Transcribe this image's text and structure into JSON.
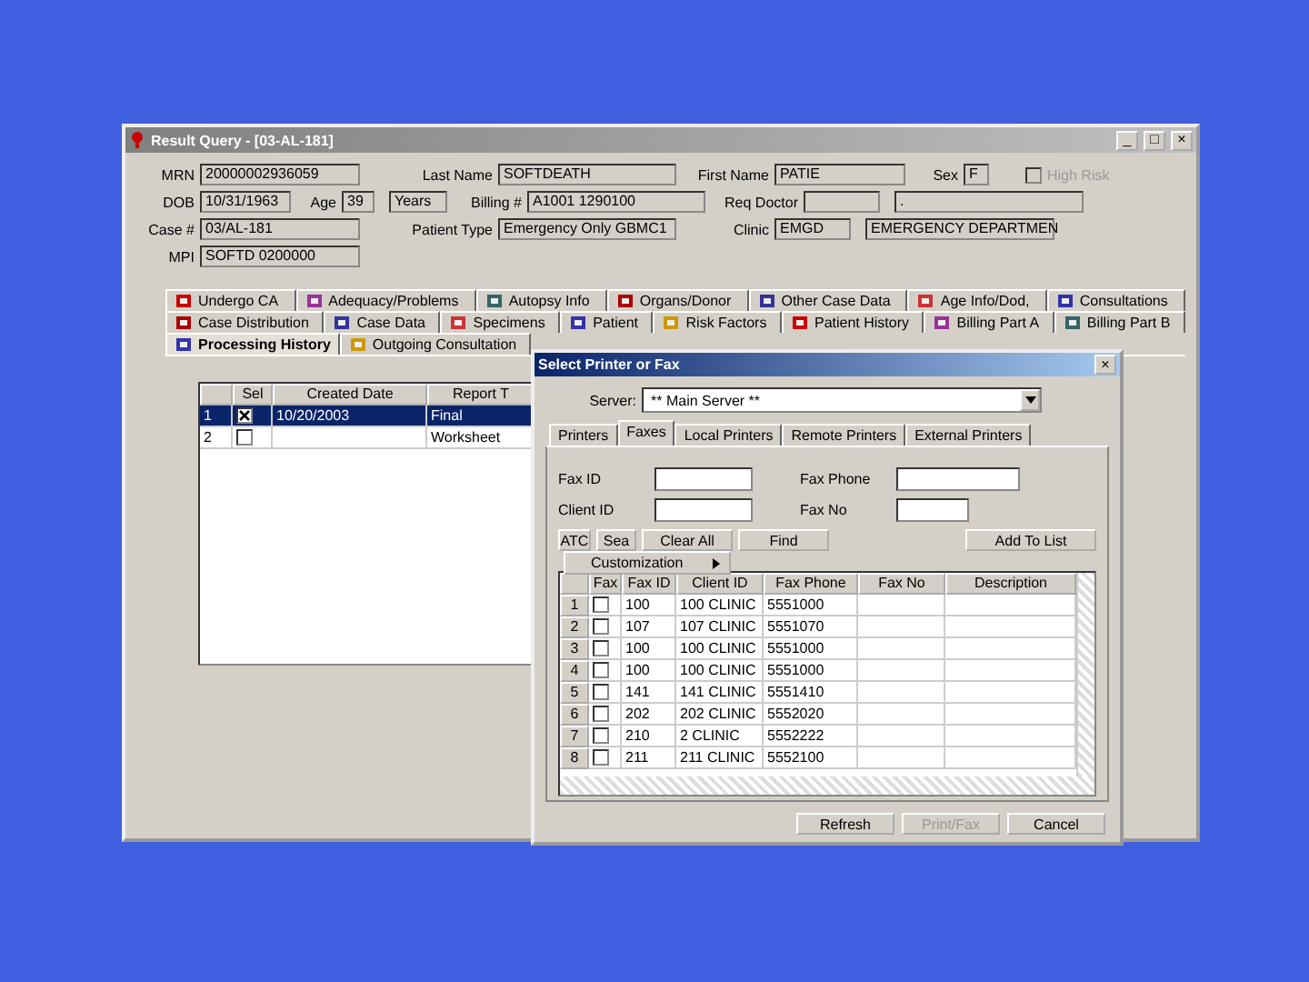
{
  "window": {
    "title": "Result Query - [03-AL-181]",
    "controls": [
      "_",
      "□",
      "×"
    ]
  },
  "header": {
    "fields": [
      {
        "label": "MRN",
        "value": "20000002936059"
      },
      {
        "label": "Last Name",
        "value": "SOFTDEATH"
      },
      {
        "label": "First Name",
        "value": "PATIE"
      },
      {
        "label": "Sex",
        "value": "F",
        "kind": "combo"
      },
      {
        "label": "High Risk",
        "kind": "check",
        "checked": false,
        "disabled": true
      },
      {
        "label": "DOB",
        "value": "10/31/1963"
      },
      {
        "label": "Age",
        "value": "39"
      },
      {
        "value": "Years"
      },
      {
        "label": "Billing #",
        "value": "A1001 1290100"
      },
      {
        "label": "Req Doctor"
      },
      {
        "value": "."
      },
      {
        "label": "Case #",
        "value": "03/AL-181"
      },
      {
        "label": "Patient Type",
        "value": "Emergency Only GBMC1"
      },
      {
        "label": "Clinic",
        "value": "EMGD"
      },
      {
        "value": "EMERGENCY DEPARTMEN"
      },
      {
        "label": "MPI",
        "value": "SOFTD 0200000"
      }
    ]
  },
  "tab_rows": [
    [
      {
        "label": "Undergo CA",
        "selected": false
      },
      {
        "label": "Adequacy/Problems",
        "selected": false
      },
      {
        "label": "Autopsy Info",
        "selected": false
      },
      {
        "label": "Organs/Donor",
        "selected": false
      },
      {
        "label": "Other Case Data",
        "selected": false
      },
      {
        "label": "Age Info/Dod,",
        "selected": false
      },
      {
        "label": "Consultations",
        "selected": false
      }
    ],
    [
      {
        "label": "Case Distribution",
        "selected": false
      },
      {
        "label": "Case Data",
        "selected": false
      },
      {
        "label": "Specimens",
        "selected": false
      },
      {
        "label": "Patient",
        "selected": false
      },
      {
        "label": "Risk Factors",
        "selected": false
      },
      {
        "label": "Patient History",
        "selected": false
      },
      {
        "label": "Billing Part A",
        "selected": false
      },
      {
        "label": "Billing Part B",
        "selected": false
      }
    ],
    [
      {
        "label": "Processing History",
        "selected": true
      },
      {
        "label": "Outgoing Consultation",
        "selected": false
      }
    ]
  ],
  "reports": {
    "columns": [
      "Sel",
      "Created Date",
      "Report T"
    ],
    "rows": [
      {
        "num": "1",
        "checked": true,
        "date": "10/20/2003",
        "type": "Final",
        "selected": true
      },
      {
        "num": "2",
        "checked": false,
        "type": "Worksheet",
        "selected": false
      }
    ]
  },
  "dialog": {
    "title": "Select Printer or Fax",
    "close": "×",
    "server_label": "Server:",
    "server": "** Main Server **",
    "tabs": [
      {
        "label": "Printers",
        "selected": false
      },
      {
        "label": "Faxes",
        "selected": true
      },
      {
        "label": "Local Printers",
        "selected": false
      },
      {
        "label": "Remote Printers",
        "selected": false
      },
      {
        "label": "External Printers",
        "selected": false
      }
    ],
    "fields": [
      {
        "label": "Fax ID"
      },
      {
        "label": "Fax Phone"
      },
      {
        "label": "Client ID"
      },
      {
        "label": "Fax No"
      }
    ],
    "buttons": [
      "ATC",
      "Sea",
      "Clear All",
      "Find",
      "Add To List"
    ],
    "menu": {
      "label": "Customization"
    },
    "columns": [
      "Fax",
      "Fax ID",
      "Client ID",
      "Fax Phone",
      "Fax No",
      "Description"
    ],
    "rows": [
      {
        "num": "1",
        "checked": false,
        "id": "100",
        "client": "100 CLINIC",
        "phone": "5551000"
      },
      {
        "num": "2",
        "checked": false,
        "id": "107",
        "client": "107 CLINIC",
        "phone": "5551070"
      },
      {
        "num": "3",
        "checked": false,
        "id": "100",
        "client": "100 CLINIC",
        "phone": "5551000"
      },
      {
        "num": "4",
        "checked": false,
        "id": "100",
        "client": "100 CLINIC",
        "phone": "5551000"
      },
      {
        "num": "5",
        "checked": false,
        "id": "141",
        "client": "141 CLINIC",
        "phone": "5551410"
      },
      {
        "num": "6",
        "checked": false,
        "id": "202",
        "client": "202 CLINIC",
        "phone": "5552020"
      },
      {
        "num": "7",
        "checked": false,
        "id": "210",
        "client": "2 CLINIC",
        "phone": "5552222"
      },
      {
        "num": "8",
        "checked": false,
        "id": "211",
        "client": "211 CLINIC",
        "phone": "5552100"
      }
    ],
    "footer": [
      {
        "label": "Refresh",
        "disabled": false
      },
      {
        "label": "Print/Fax",
        "disabled": true
      },
      {
        "label": "Cancel",
        "disabled": false
      }
    ]
  }
}
